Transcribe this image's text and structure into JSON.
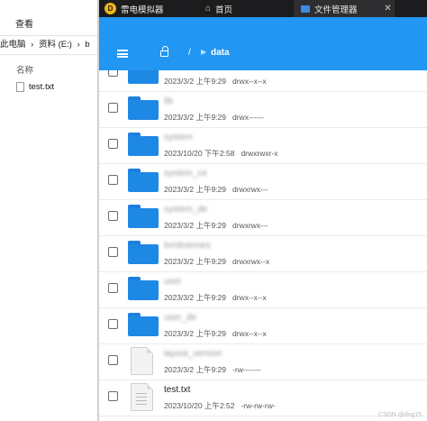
{
  "explorer": {
    "menu_view": "查看",
    "address": [
      "此电脑",
      "资料 (E:)",
      "b"
    ],
    "column_name": "名称",
    "file": "test.txt"
  },
  "titlebar": {
    "app_tab": "雷电模拟器",
    "app_logo": "D",
    "home_tab": "首页",
    "fm_tab": "文件管理器",
    "close_glyph": "✕"
  },
  "header": {
    "root": "/",
    "folder": "data"
  },
  "files": [
    {
      "name": "",
      "date": "2023/3/2 上午9:29",
      "perm": "drwx--x--x",
      "type": "folder",
      "blurred": true
    },
    {
      "name": "lib",
      "date": "2023/3/2 上午9:29",
      "perm": "drwx------",
      "type": "folder",
      "blurred": true
    },
    {
      "name": "system",
      "date": "2023/10/20 下午2:58",
      "perm": "drwxrwxr-x",
      "type": "folder",
      "blurred": true
    },
    {
      "name": "system_ce",
      "date": "2023/3/2 上午9:29",
      "perm": "drwxrwx---",
      "type": "folder",
      "blurred": true
    },
    {
      "name": "system_de",
      "date": "2023/3/2 上午9:29",
      "perm": "drwxrwx---",
      "type": "folder",
      "blurred": true
    },
    {
      "name": "tombstones",
      "date": "2023/3/2 上午9:29",
      "perm": "drwxrwx--x",
      "type": "folder",
      "blurred": true
    },
    {
      "name": "user",
      "date": "2023/3/2 上午9:29",
      "perm": "drwx--x--x",
      "type": "folder",
      "blurred": true
    },
    {
      "name": "user_de",
      "date": "2023/3/2 上午9:29",
      "perm": "drwx--x--x",
      "type": "folder",
      "blurred": true
    },
    {
      "name": "layout_version",
      "date": "2023/3/2 上午9:29",
      "perm": "-rw-------",
      "type": "file",
      "blurred": true
    },
    {
      "name": "test.txt",
      "date": "2023/10/20 上午2:52",
      "perm": "-rw-rw-rw-",
      "type": "file",
      "blurred": false
    }
  ],
  "watermark": "CSDN @ifng15"
}
